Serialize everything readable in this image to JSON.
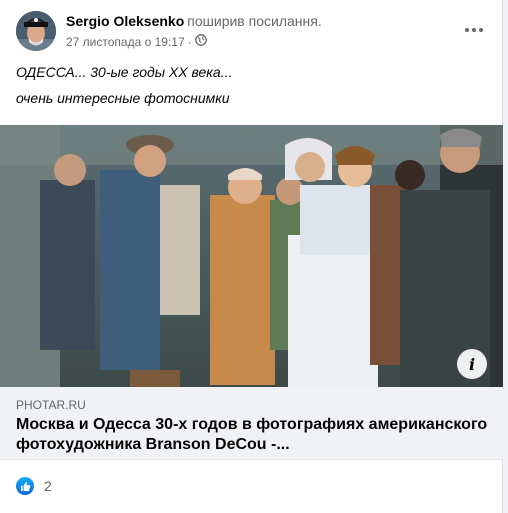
{
  "post": {
    "author": "Sergio Oleksenko",
    "action": "поширив посилання.",
    "timestamp": "27 листопада о 19:17",
    "separator": "·",
    "audience_icon": "globe-icon",
    "more_icon": "more-options-icon",
    "text_line1": "ОДЕССА... 30-ые годы ХХ века...",
    "text_line2": "очень интересные фотоснимки"
  },
  "link": {
    "domain": "PHOTAR.RU",
    "title": "Москва и Одесса 30-х годов в фотографиях американского фотохудожника Branson DeCou -...",
    "info_icon_label": "i"
  },
  "reactions": {
    "icon": "like-icon",
    "count": "2",
    "color": "#1877f2"
  }
}
